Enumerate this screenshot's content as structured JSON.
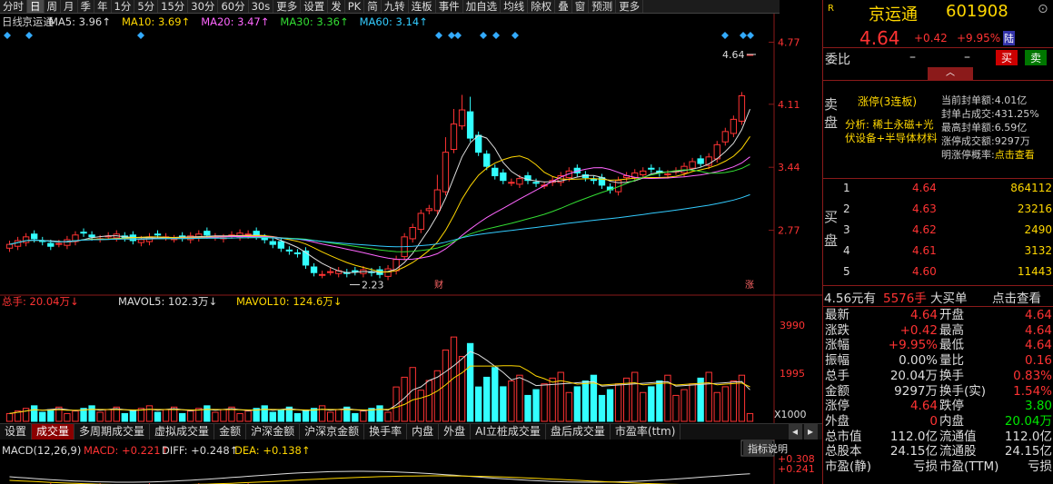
{
  "toolbar": {
    "items": [
      "分时",
      "日",
      "周",
      "月",
      "季",
      "年",
      "1分",
      "5分",
      "15分",
      "30分",
      "60分",
      "30s",
      "更多",
      "设置",
      "发",
      "PK",
      "简",
      "九转",
      "连板",
      "事件",
      "加自选",
      "均线",
      "除权",
      "叠",
      "窗",
      "预测",
      "更多"
    ]
  },
  "chart_header": {
    "period": "日线",
    "stock": "京运通",
    "ma5": "MA5: 3.96↑",
    "ma10": "MA10: 3.69↑",
    "ma20": "MA20: 3.47↑",
    "ma30": "MA30: 3.36↑",
    "ma60": "MA60: 3.14↑"
  },
  "price_axis": {
    "labels": [
      "4.77",
      "4.11",
      "3.44",
      "2.77"
    ],
    "current": "4.64",
    "low_label": "2.23",
    "fin_mark": "财",
    "limit_mark": "涨"
  },
  "vol_header": {
    "total": "总手: 20.04万↓",
    "mavol5": "MAVOL5: 102.3万↓",
    "mavol10": "MAVOL10: 124.6万↓"
  },
  "vol_axis": {
    "labels": [
      "3990",
      "1995"
    ],
    "unit": "X1000"
  },
  "tabs": {
    "items": [
      "设置",
      "成交量",
      "多周期成交量",
      "虚拟成交量",
      "金额",
      "沪深金额",
      "沪深京金额",
      "换手率",
      "内盘",
      "外盘",
      "AI立桩成交量",
      "盘后成交量",
      "市盈率(ttm)"
    ],
    "active": "成交量"
  },
  "macd_header": {
    "title": "MACD(12,26,9)",
    "macd": "MACD: +0.221↑",
    "diff": "DIFF: +0.248↑",
    "dea": "DEA: +0.138↑",
    "help": "指标说明",
    "axis": [
      "+0.308",
      "+0.241"
    ]
  },
  "quote": {
    "market_tag": "R",
    "name": "京运通",
    "code": "601908",
    "price": "4.64",
    "change": "+0.42",
    "pct": "+9.95%",
    "exchange": "陆",
    "weibi_label": "委比",
    "weibi_val": "–",
    "weibi_val2": "–",
    "buy_btn": "买",
    "sell_btn": "卖",
    "sell_label": "卖盘",
    "buy_label": "买盘",
    "limit_title": "涨停(3连板)",
    "analysis": "分析: 稀土永磁+光伏设备+半导体材料",
    "limit_info": [
      [
        "当前封单额:",
        "4.01亿"
      ],
      [
        "封单占成交:",
        "431.25%"
      ],
      [
        "最高封单额:",
        "6.59亿"
      ],
      [
        "涨停成交额:",
        "9297万"
      ],
      [
        "明涨停概率:",
        "点击查看"
      ]
    ],
    "bids": [
      [
        "1",
        "4.64",
        "864112"
      ],
      [
        "2",
        "4.63",
        "23216"
      ],
      [
        "3",
        "4.62",
        "2490"
      ],
      [
        "4",
        "4.61",
        "3132"
      ],
      [
        "5",
        "4.60",
        "11443"
      ]
    ],
    "big_buy": {
      "price": "4.56元有",
      "vol": "5576手",
      "text": "大买单",
      "link": "点击查看"
    },
    "stats": [
      [
        "最新",
        "4.64",
        "开盘",
        "4.64"
      ],
      [
        "涨跌",
        "+0.42",
        "最高",
        "4.64"
      ],
      [
        "涨幅",
        "+9.95%",
        "最低",
        "4.64"
      ],
      [
        "振幅",
        "0.00%",
        "量比",
        "0.16"
      ],
      [
        "总手",
        "20.04万",
        "换手",
        "0.83%"
      ],
      [
        "金额",
        "9297万",
        "换手(实)",
        "1.54%"
      ],
      [
        "涨停",
        "4.64",
        "跌停",
        "3.80"
      ],
      [
        "外盘",
        "0",
        "内盘",
        "20.04万"
      ],
      [
        "总市值",
        "112.0亿",
        "流通值",
        "112.0亿"
      ],
      [
        "总股本",
        "24.15亿",
        "流通股",
        "24.15亿"
      ],
      [
        "市盈(静)",
        "亏损",
        "市盈(TTM)",
        "亏损"
      ]
    ]
  },
  "chart_data": {
    "type": "candlestick",
    "note_series": [
      "MA5",
      "MA10",
      "MA20",
      "MA30",
      "MA60"
    ],
    "closes": [
      2.62,
      2.66,
      2.7,
      2.68,
      2.65,
      2.6,
      2.63,
      2.67,
      2.72,
      2.74,
      2.7,
      2.68,
      2.71,
      2.73,
      2.69,
      2.66,
      2.67,
      2.7,
      2.72,
      2.7,
      2.68,
      2.69,
      2.71,
      2.73,
      2.72,
      2.7,
      2.69,
      2.72,
      2.74,
      2.73,
      2.71,
      2.67,
      2.62,
      2.58,
      2.55,
      2.52,
      2.4,
      2.32,
      2.3,
      2.33,
      2.34,
      2.31,
      2.33,
      2.35,
      2.32,
      2.3,
      2.36,
      2.46,
      2.7,
      2.8,
      2.95,
      3.0,
      3.2,
      3.6,
      3.9,
      4.05,
      3.75,
      3.6,
      3.45,
      3.35,
      3.3,
      3.28,
      3.32,
      3.3,
      3.27,
      3.25,
      3.3,
      3.35,
      3.4,
      3.38,
      3.33,
      3.3,
      3.25,
      3.2,
      3.3,
      3.35,
      3.38,
      3.4,
      3.42,
      3.38,
      3.37,
      3.4,
      3.45,
      3.5,
      3.48,
      3.55,
      3.68,
      3.82,
      3.95,
      4.2,
      4.64
    ],
    "ylim": [
      2.1,
      4.9
    ]
  }
}
